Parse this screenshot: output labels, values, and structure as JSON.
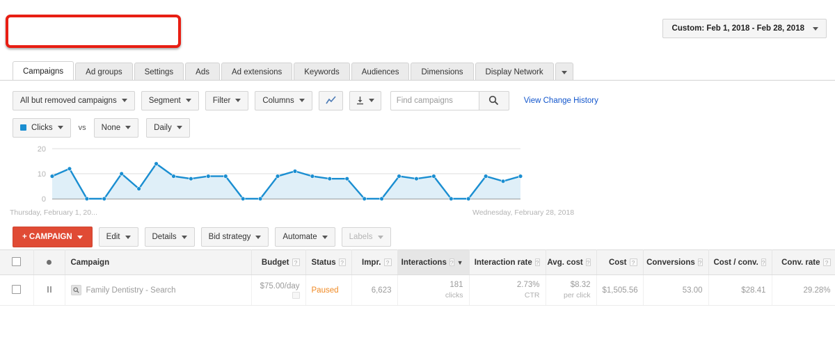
{
  "header": {
    "redaction_box": "",
    "date_range": {
      "label": "Custom: Feb 1, 2018 - Feb 28, 2018",
      "caret": "chevron-down-icon"
    }
  },
  "tabs": [
    {
      "label": "Campaigns",
      "active": true
    },
    {
      "label": "Ad groups",
      "active": false
    },
    {
      "label": "Settings",
      "active": false
    },
    {
      "label": "Ads",
      "active": false
    },
    {
      "label": "Ad extensions",
      "active": false
    },
    {
      "label": "Keywords",
      "active": false
    },
    {
      "label": "Audiences",
      "active": false
    },
    {
      "label": "Dimensions",
      "active": false
    },
    {
      "label": "Display Network",
      "active": false
    }
  ],
  "toolbar": {
    "filter_scope": "All but removed campaigns",
    "segment": "Segment",
    "filter": "Filter",
    "columns": "Columns",
    "chart_icon": "line-chart-icon",
    "download_icon": "download-icon",
    "search_placeholder": "Find campaigns",
    "search_value": "",
    "search_icon": "search-icon",
    "change_history_link": "View Change History"
  },
  "chart_controls": {
    "metric_primary": "Clicks",
    "metric_primary_color": "#1a8ed1",
    "vs_label": "vs",
    "metric_secondary": "None",
    "granularity": "Daily"
  },
  "chart_data": {
    "type": "area",
    "title": "",
    "xlabel": "",
    "ylabel": "Clicks",
    "ylim": [
      0,
      20
    ],
    "yticks": [
      0,
      10,
      20
    ],
    "grid": true,
    "legend": [
      "Clicks"
    ],
    "legend_position": "top-left",
    "axis_start_label": "Thursday, February 1, 20...",
    "axis_end_label": "Wednesday, February 28, 2018",
    "x": [
      "Feb 1",
      "Feb 2",
      "Feb 3",
      "Feb 4",
      "Feb 5",
      "Feb 6",
      "Feb 7",
      "Feb 8",
      "Feb 9",
      "Feb 10",
      "Feb 11",
      "Feb 12",
      "Feb 13",
      "Feb 14",
      "Feb 15",
      "Feb 16",
      "Feb 17",
      "Feb 18",
      "Feb 19",
      "Feb 20",
      "Feb 21",
      "Feb 22",
      "Feb 23",
      "Feb 24",
      "Feb 25",
      "Feb 26",
      "Feb 27",
      "Feb 28"
    ],
    "series": [
      {
        "name": "Clicks",
        "color": "#1a8ed1",
        "fill": "#d9ecf7",
        "values": [
          9,
          12,
          0,
          0,
          10,
          4,
          14,
          9,
          8,
          9,
          9,
          0,
          0,
          9,
          11,
          9,
          8,
          8,
          0,
          0,
          9,
          8,
          9,
          0,
          0,
          9,
          7,
          9
        ]
      }
    ]
  },
  "actions": {
    "new_campaign": "+ CAMPAIGN",
    "edit": "Edit",
    "details": "Details",
    "bid_strategy": "Bid strategy",
    "automate": "Automate",
    "labels": "Labels"
  },
  "table": {
    "columns": [
      {
        "label": "",
        "help": false,
        "type": "checkbox"
      },
      {
        "label": "",
        "help": false,
        "type": "dot"
      },
      {
        "label": "Campaign",
        "help": false,
        "type": "text"
      },
      {
        "label": "Budget",
        "help": true,
        "type": "num"
      },
      {
        "label": "Status",
        "help": true,
        "type": "text"
      },
      {
        "label": "Impr.",
        "help": true,
        "type": "num"
      },
      {
        "label": "Interactions",
        "help": true,
        "type": "num",
        "sorted": true,
        "sort_dir": "desc"
      },
      {
        "label": "Interaction rate",
        "help": true,
        "type": "num"
      },
      {
        "label": "Avg. cost",
        "help": true,
        "type": "num"
      },
      {
        "label": "Cost",
        "help": true,
        "type": "num"
      },
      {
        "label": "Conversions",
        "help": true,
        "type": "num"
      },
      {
        "label": "Cost / conv.",
        "help": true,
        "type": "num"
      },
      {
        "label": "Conv. rate",
        "help": true,
        "type": "num"
      }
    ],
    "rows": [
      {
        "status_icon": "pause-icon",
        "type_icon": "search-campaign-icon",
        "campaign": "Family Dentistry - Search",
        "budget": "$75.00/day",
        "status": "Paused",
        "impressions": "6,623",
        "interactions": "181",
        "interactions_sub": "clicks",
        "interaction_rate": "2.73%",
        "interaction_rate_sub": "CTR",
        "avg_cost": "$8.32",
        "avg_cost_sub": "per click",
        "cost": "$1,505.56",
        "conversions": "53.00",
        "cost_per_conv": "$28.41",
        "conv_rate": "29.28%"
      }
    ]
  }
}
